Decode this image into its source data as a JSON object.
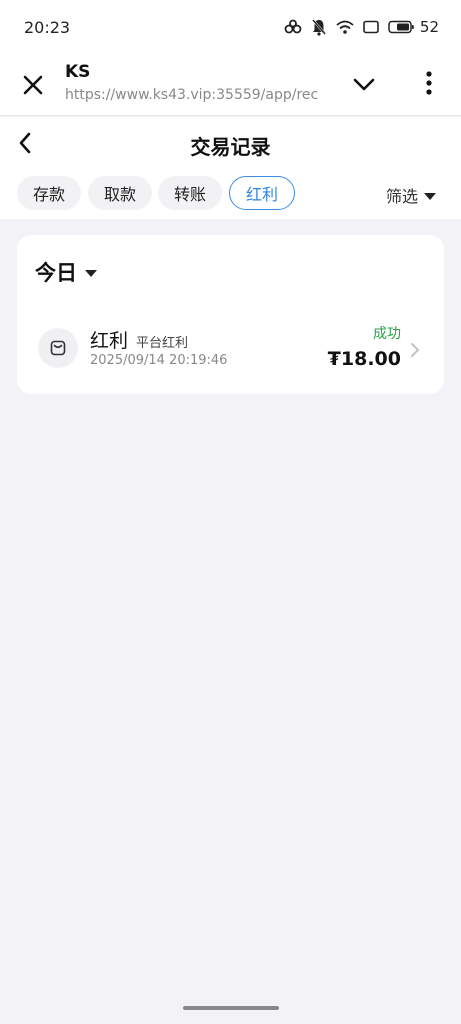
{
  "status_bar": {
    "time": "20:23",
    "battery": "52",
    "icons": [
      "link-icon",
      "mute-icon",
      "wifi-icon",
      "screen-icon",
      "battery-icon"
    ]
  },
  "browser": {
    "title": "KS",
    "url": "https://www.ks43.vip:35559/app/rec",
    "icons": [
      "close-icon",
      "chevron-down-icon",
      "more-vertical-icon"
    ]
  },
  "header": {
    "title": "交易记录",
    "back_icon": "chevron-left-icon"
  },
  "tabs": [
    {
      "label": "存款",
      "active": false
    },
    {
      "label": "取款",
      "active": false
    },
    {
      "label": "转账",
      "active": false
    },
    {
      "label": "红利",
      "active": true
    }
  ],
  "filter": {
    "label": "筛选",
    "icon": "caret-down-icon"
  },
  "group": {
    "date_label": "今日",
    "items": [
      {
        "type": "红利",
        "subtype": "平台红利",
        "time": "2025/09/14 20:19:46",
        "status": "成功",
        "amount": "₮18.00",
        "icon": "wallet-icon"
      }
    ]
  },
  "colors": {
    "accent": "#2f86e0",
    "success": "#2aa04a",
    "background": "#f2f2f7"
  }
}
